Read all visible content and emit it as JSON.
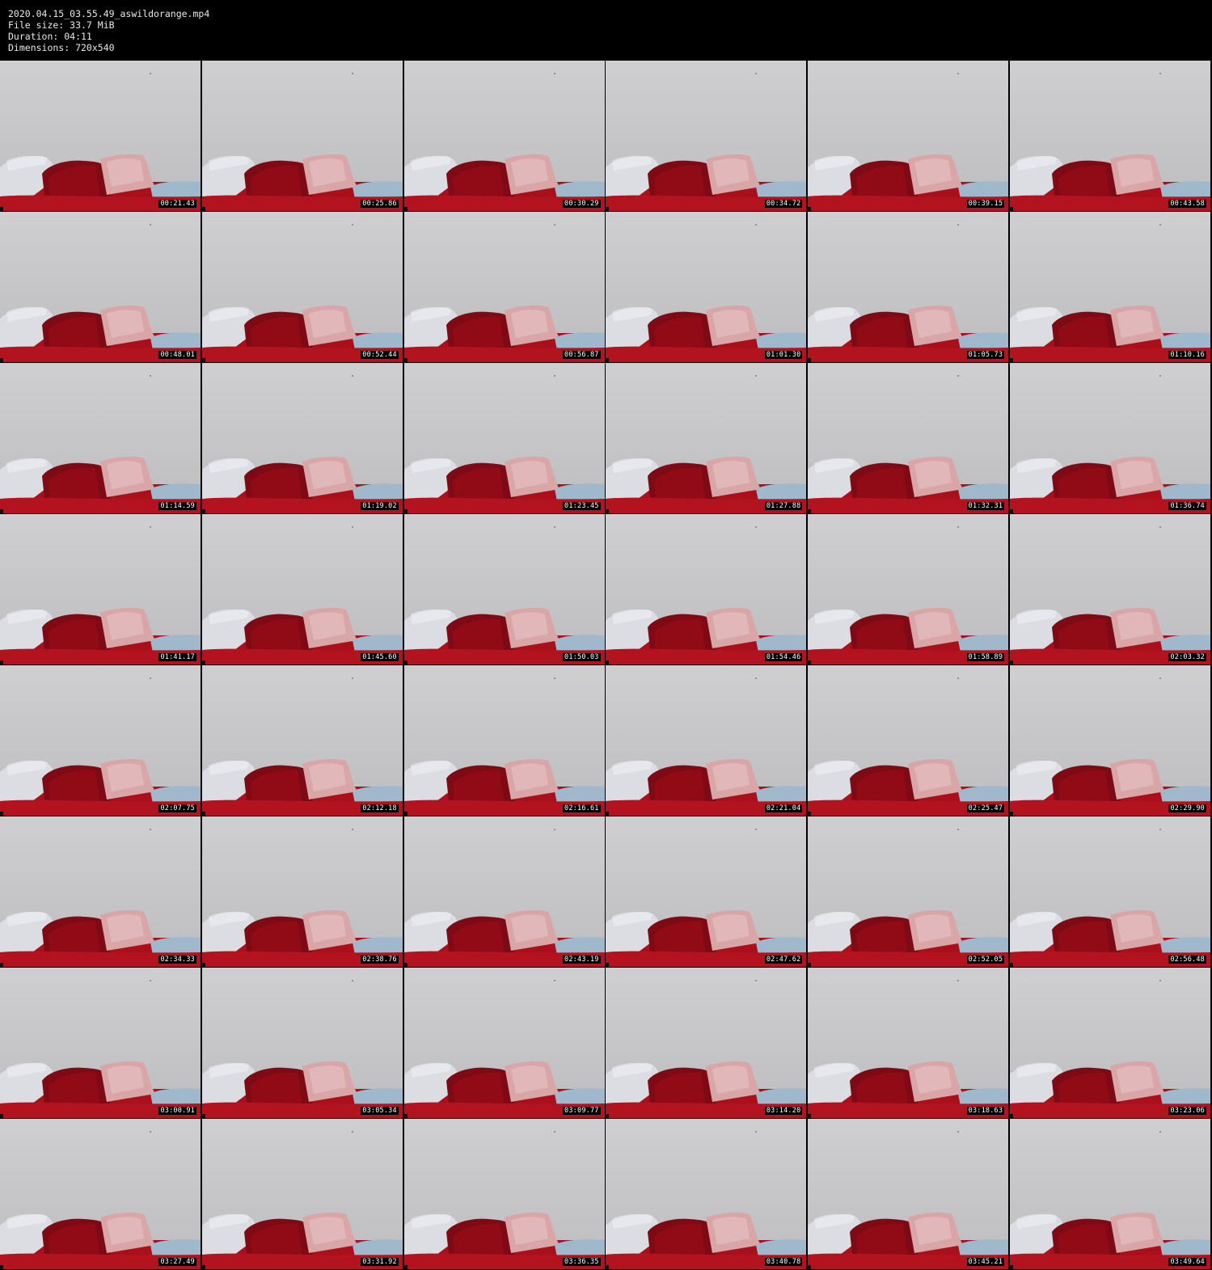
{
  "header": {
    "filename": "2020.04.15_03.55.49_aswildorange.mp4",
    "file_size": "File size: 33.7 MiB",
    "duration": "Duration: 04:11",
    "dimensions": "Dimensions: 720x540"
  },
  "grid": {
    "columns": 6,
    "rows": 8,
    "timestamps": [
      "00:21.43",
      "00:25.86",
      "00:30.29",
      "00:34.72",
      "00:39.15",
      "00:43.58",
      "00:48.01",
      "00:52.44",
      "00:56.87",
      "01:01.30",
      "01:05.73",
      "01:10.16",
      "01:14.59",
      "01:19.02",
      "01:23.45",
      "01:27.88",
      "01:32.31",
      "01:36.74",
      "01:41.17",
      "01:45.60",
      "01:50.03",
      "01:54.46",
      "01:58.89",
      "02:03.32",
      "02:07.75",
      "02:12.18",
      "02:16.61",
      "02:21.04",
      "02:25.47",
      "02:29.90",
      "02:34.33",
      "02:38.76",
      "02:43.19",
      "02:47.62",
      "02:52.05",
      "02:56.48",
      "03:00.91",
      "03:05.34",
      "03:09.77",
      "03:14.20",
      "03:18.63",
      "03:23.06",
      "03:27.49",
      "03:31.92",
      "03:36.35",
      "03:40.78",
      "03:45.21",
      "03:49.64"
    ]
  },
  "colors": {
    "wall": "#c7c7c9",
    "red_fabric": "#a9101c",
    "dark_red": "#7d0a14",
    "white_pillow": "#dcdde3",
    "pink_pillow": "#d9a6a8",
    "blue_object": "#9fb8cc"
  },
  "icons": [
    "video-frame-thumbnail"
  ]
}
